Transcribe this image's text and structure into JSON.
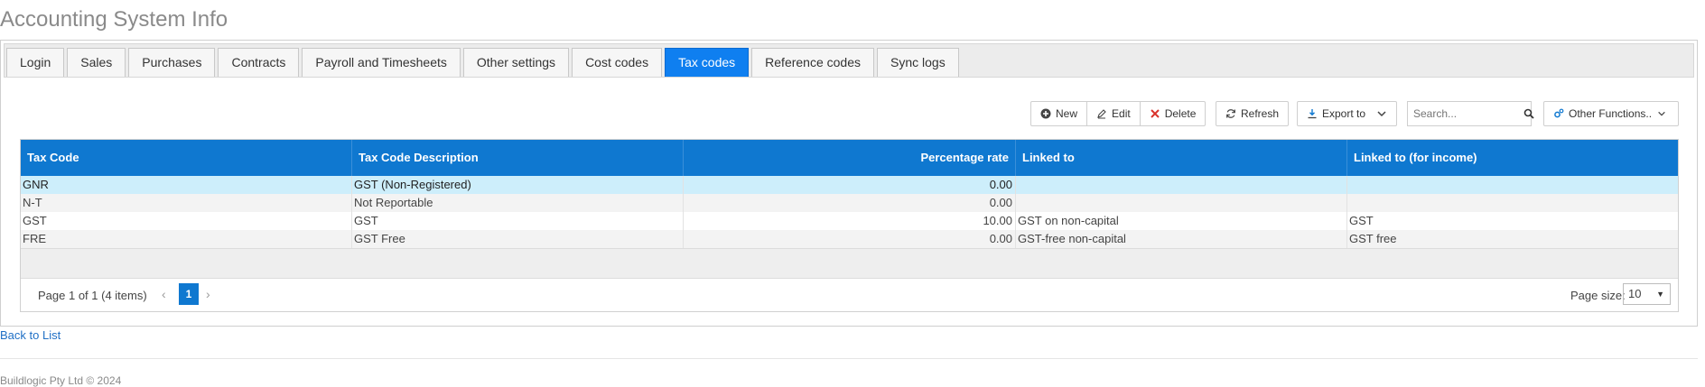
{
  "page": {
    "title": "Accounting System Info"
  },
  "tabs": [
    {
      "label": "Login"
    },
    {
      "label": "Sales"
    },
    {
      "label": "Purchases"
    },
    {
      "label": "Contracts"
    },
    {
      "label": "Payroll and Timesheets"
    },
    {
      "label": "Other settings"
    },
    {
      "label": "Cost codes"
    },
    {
      "label": "Tax codes",
      "active": true
    },
    {
      "label": "Reference codes"
    },
    {
      "label": "Sync logs"
    }
  ],
  "toolbar": {
    "new_label": "New",
    "edit_label": "Edit",
    "delete_label": "Delete",
    "refresh_label": "Refresh",
    "export_label": "Export to",
    "search_placeholder": "Search...",
    "other_label": "Other Functions.."
  },
  "grid": {
    "columns": [
      "Tax Code",
      "Tax Code Description",
      "Percentage rate",
      "Linked to",
      "Linked to (for income)"
    ],
    "rows": [
      {
        "code": "GNR",
        "description": "GST (Non-Registered)",
        "rate": "0.00",
        "linked": "",
        "linked_income": "",
        "selected": true
      },
      {
        "code": "N-T",
        "description": "Not Reportable",
        "rate": "0.00",
        "linked": "",
        "linked_income": ""
      },
      {
        "code": "GST",
        "description": "GST",
        "rate": "10.00",
        "linked": "GST on non-capital",
        "linked_income": "GST"
      },
      {
        "code": "FRE",
        "description": "GST Free",
        "rate": "0.00",
        "linked": "GST-free non-capital",
        "linked_income": "GST free"
      }
    ]
  },
  "pager": {
    "info": "Page 1 of 1 (4 items)",
    "current_page": "1",
    "page_size_label": "Page size:",
    "page_size": "10"
  },
  "links": {
    "back": "Back to List"
  },
  "footer": {
    "text": "Buildlogic Pty Ltd © 2024"
  },
  "colors": {
    "accent": "#0f78d0",
    "active_tab": "#0f7ff0",
    "selected_row": "#cdeefb",
    "delete_icon": "#d9322b"
  }
}
